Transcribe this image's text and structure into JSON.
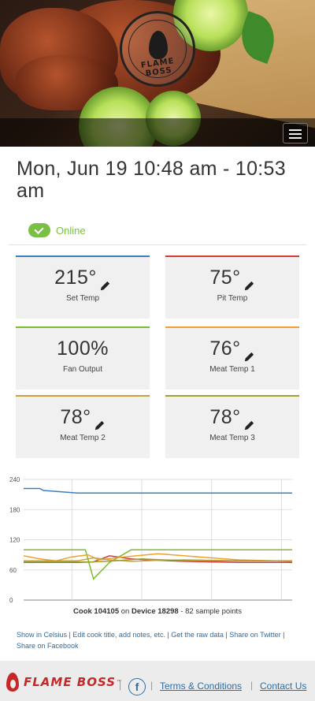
{
  "hero": {
    "logo_text": "FLAME BOSS"
  },
  "header": {
    "menu_icon": "hamburger-menu-icon"
  },
  "cook": {
    "title": "Mon, Jun 19 10:48 am - 10:53 am",
    "status": "Online"
  },
  "tiles": [
    {
      "value": "215°",
      "label": "Set Temp",
      "color": "#3d7ebf",
      "editable": true
    },
    {
      "value": "75°",
      "label": "Pit Temp",
      "color": "#d63a35",
      "editable": true
    },
    {
      "value": "100%",
      "label": "Fan Output",
      "color": "#7bbd2c",
      "editable": false
    },
    {
      "value": "76°",
      "label": "Meat Temp 1",
      "color": "#f0a030",
      "editable": true
    },
    {
      "value": "78°",
      "label": "Meat Temp 2",
      "color": "#c8a040",
      "editable": true
    },
    {
      "value": "78°",
      "label": "Meat Temp 3",
      "color": "#a0a030",
      "editable": true
    }
  ],
  "chart_data": {
    "type": "line",
    "title": "",
    "xlabel": "",
    "ylabel": "",
    "ylim": [
      0,
      240
    ],
    "yticks": [
      "0",
      "60",
      "120",
      "180",
      "240"
    ],
    "grid": true,
    "series": [
      {
        "color": "#3d7ebf",
        "x": [
          0,
          0.3,
          0.37,
          1,
          1.35,
          5
        ],
        "y": [
          222,
          222,
          218,
          213,
          213,
          213
        ]
      },
      {
        "color": "#7bbd2c",
        "x": [
          0,
          0.6,
          0.9,
          1.0,
          1.15,
          1.3,
          1.6,
          2,
          3,
          4,
          5
        ],
        "y": [
          100,
          100,
          100,
          100,
          100,
          42,
          75,
          100,
          100,
          100,
          100
        ]
      },
      {
        "color": "#d63a35",
        "x": [
          0,
          0.5,
          1.0,
          1.3,
          1.6,
          2,
          2.5,
          3,
          3.5,
          4,
          5
        ],
        "y": [
          75,
          75,
          75,
          76,
          88,
          82,
          79,
          77,
          76,
          75,
          75
        ]
      },
      {
        "color": "#f0a030",
        "x": [
          0,
          0.3,
          0.6,
          0.9,
          1.2,
          1.4,
          1.8,
          2.5,
          3,
          3.5,
          4,
          5
        ],
        "y": [
          88,
          82,
          78,
          86,
          90,
          80,
          85,
          92,
          88,
          84,
          80,
          77
        ]
      },
      {
        "color": "#c8a040",
        "x": [
          0,
          0.5,
          1.0,
          1.3,
          1.6,
          2,
          2.5,
          3,
          3.5,
          4,
          5
        ],
        "y": [
          78,
          78,
          78,
          84,
          80,
          77,
          79,
          80,
          79,
          78,
          78
        ]
      },
      {
        "color": "#a0a030",
        "x": [
          0,
          0.5,
          1.0,
          1.3,
          1.7,
          2.2,
          2.6,
          3.2,
          4,
          5
        ],
        "y": [
          76,
          76,
          76,
          76,
          78,
          82,
          80,
          78,
          78,
          78
        ]
      }
    ],
    "caption": {
      "cook_label": "Cook",
      "cook_id": "104105",
      "on": "on",
      "device_label": "Device",
      "device_id": "18298",
      "samples": "- 82 sample points"
    }
  },
  "links": {
    "celsius": "Show in Celsius",
    "edit": "Edit cook title, add notes, etc.",
    "raw": "Get the raw data",
    "twitter": "Share on Twitter",
    "facebook": "Share on Facebook",
    "separator": "|"
  },
  "footer": {
    "brand": "FLAME BOSS",
    "trademark": "™",
    "facebook_icon": "f",
    "terms": "Terms & Conditions",
    "contact": "Contact Us",
    "separator": "|"
  }
}
